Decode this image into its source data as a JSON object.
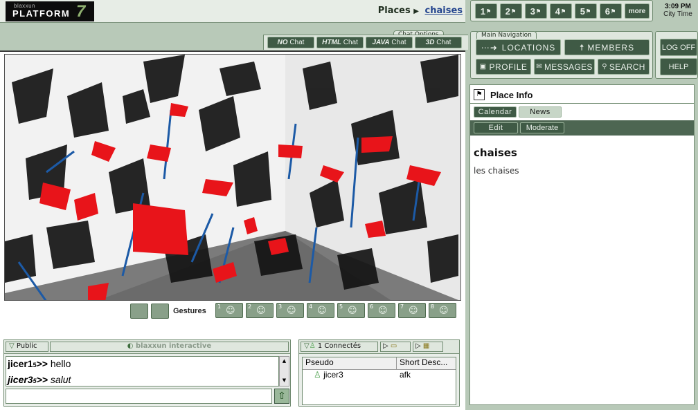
{
  "brand": {
    "small": "blaxxun",
    "name": "PLATFORM",
    "version": "7"
  },
  "header": {
    "places_label": "Places",
    "current_place": "chaises"
  },
  "quick_nav": {
    "items": [
      "1",
      "2",
      "3",
      "4",
      "5",
      "6"
    ],
    "more": "more"
  },
  "clock": {
    "time": "3:09 PM",
    "label": "City Time"
  },
  "chat_options": {
    "title": "Chat Options",
    "buttons": [
      {
        "style": "NO",
        "label": "Chat"
      },
      {
        "style": "HTML",
        "label": "Chat"
      },
      {
        "style": "JAVA",
        "label": "Chat"
      },
      {
        "style": "3D",
        "label": "Chat"
      }
    ]
  },
  "main_nav": {
    "title": "Main Navigation",
    "locations": "LOCATIONS",
    "members": "MEMBERS",
    "profile": "PROFILE",
    "messages": "MESSAGES",
    "search": "SEARCH"
  },
  "account": {
    "logoff": "LOG OFF",
    "help": "HELP"
  },
  "gestures": {
    "label": "Gestures",
    "slots": [
      "1",
      "2",
      "3",
      "4",
      "5",
      "6",
      "7",
      "8"
    ]
  },
  "chat": {
    "tab": "Public",
    "channel": "blaxxun interactive",
    "messages": [
      {
        "user": "jicer1",
        "sub": "5",
        "sep": ">>",
        "text": "hello",
        "italic": false
      },
      {
        "user": "jicer3",
        "sub": "5",
        "sep": ">>",
        "text": "salut",
        "italic": true
      }
    ]
  },
  "users": {
    "count_label": "1 Connectés",
    "col_pseudo": "Pseudo",
    "col_desc": "Short Desc...",
    "rows": [
      {
        "pseudo": "jicer3",
        "desc": "afk"
      }
    ]
  },
  "place_info": {
    "title": "Place Info",
    "tabs": [
      "Calendar",
      "News"
    ],
    "actions": [
      "Edit",
      "Moderate"
    ],
    "name": "chaises",
    "description": "les chaises"
  },
  "colors": {
    "panel": "#dfe7de",
    "button": "#3f5a45",
    "accent_red": "#e8141a",
    "accent_blue": "#1c5aa6"
  }
}
